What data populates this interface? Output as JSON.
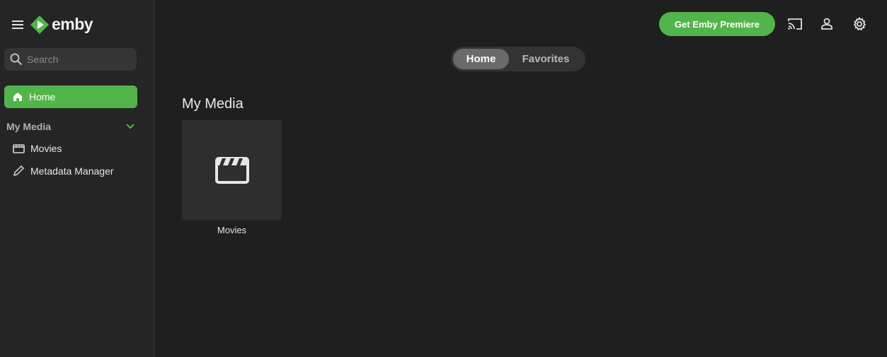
{
  "app": {
    "logo_text": "emby"
  },
  "sidebar": {
    "search_placeholder": "Search",
    "home_label": "Home",
    "section_title": "My Media",
    "items": [
      {
        "label": "Movies",
        "icon": "movie-icon"
      },
      {
        "label": "Metadata Manager",
        "icon": "pencil-icon"
      }
    ]
  },
  "header": {
    "premiere_label": "Get Emby Premiere",
    "icons": [
      "cast-icon",
      "user-icon",
      "gear-icon"
    ]
  },
  "tabs": [
    {
      "label": "Home",
      "active": true
    },
    {
      "label": "Favorites",
      "active": false
    }
  ],
  "main": {
    "section_title": "My Media",
    "libraries": [
      {
        "label": "Movies",
        "icon": "clapperboard-icon"
      }
    ]
  },
  "colors": {
    "accent": "#52b54b",
    "background": "#1f1f1f",
    "sidebar": "#252525"
  }
}
